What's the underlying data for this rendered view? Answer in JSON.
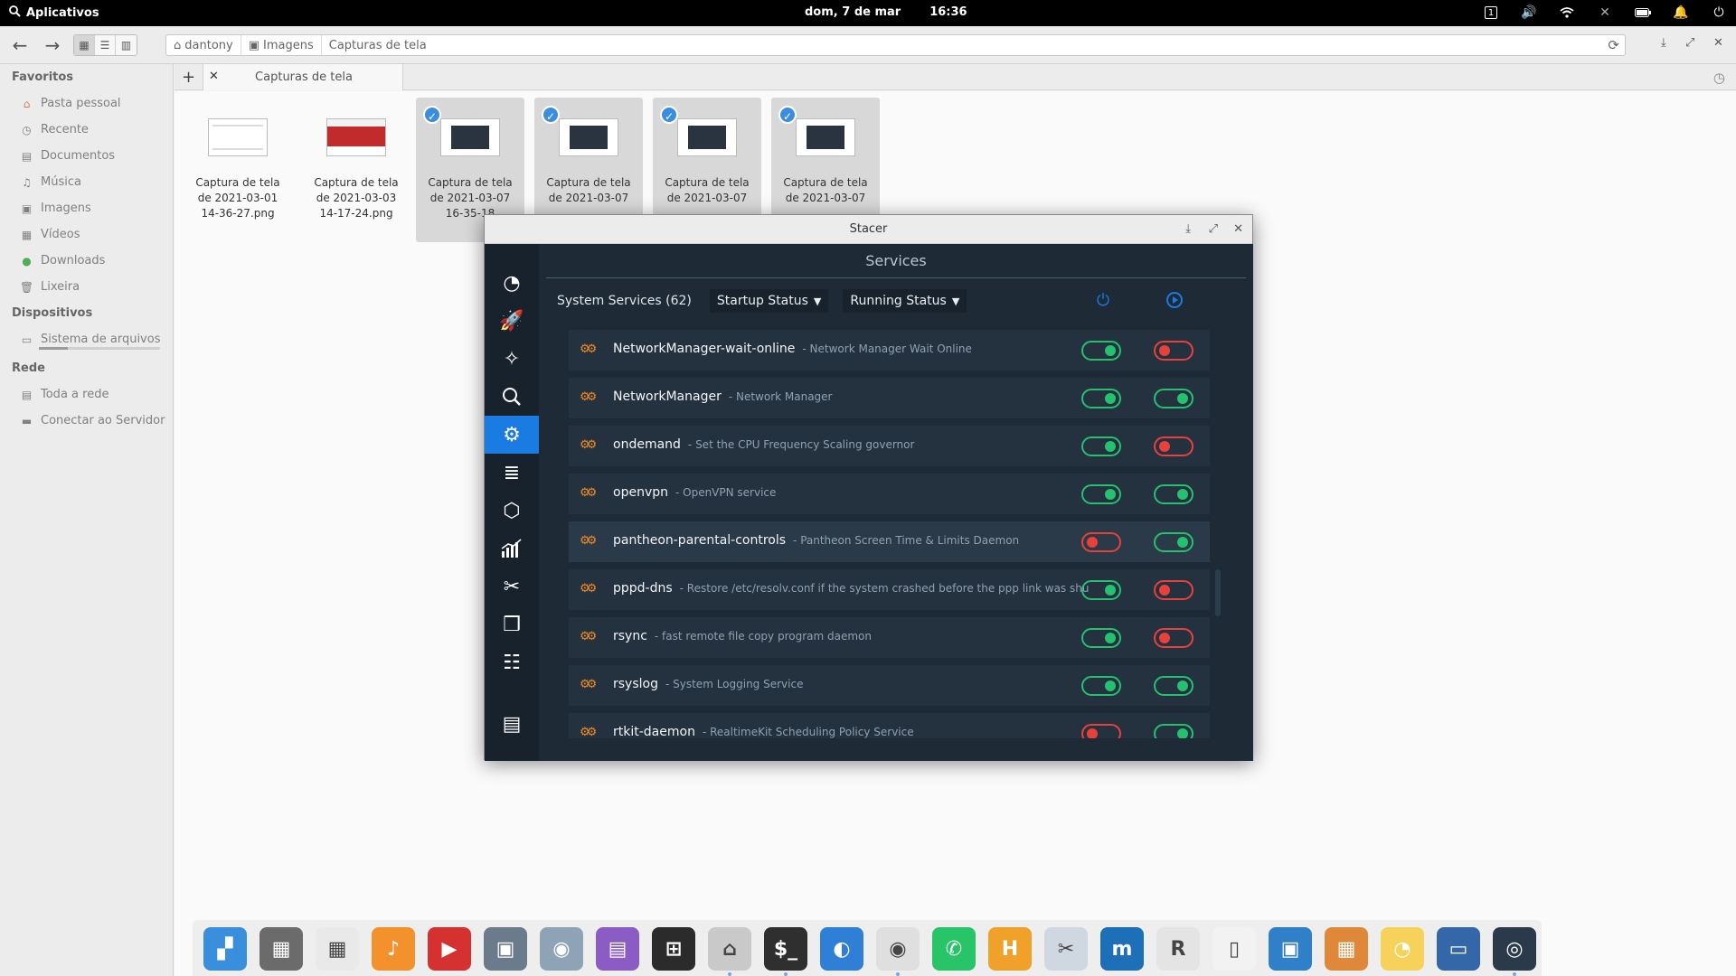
{
  "topbar": {
    "apps_label": "Aplicativos",
    "date": "dom, 7 de mar",
    "time": "16:36",
    "indicators": [
      "workspace-1",
      "volume-icon",
      "wifi-icon",
      "bluetooth-icon",
      "battery-icon",
      "notifications-icon",
      "power-icon"
    ],
    "workspace_label": "1"
  },
  "toolbar": {
    "back_icon": "back-arrow",
    "forward_icon": "forward-arrow",
    "breadcrumbs": [
      "dantony",
      "Imagens",
      "Capturas de tela"
    ]
  },
  "sidebar": {
    "sections": {
      "favorites": "Favoritos",
      "devices": "Dispositivos",
      "network": "Rede"
    },
    "favorites": [
      "Pasta pessoal",
      "Recente",
      "Documentos",
      "Música",
      "Imagens",
      "Vídeos",
      "Downloads",
      "Lixeira"
    ],
    "devices": [
      "Sistema de arquivos"
    ],
    "filesystem_usage_fraction": 0.24,
    "network": [
      "Toda a rede",
      "Conectar ao Servidor"
    ]
  },
  "tabs": {
    "active_label": "Capturas de tela"
  },
  "files": [
    {
      "name": "Captura de tela de 2021-03-01 14-36-27.png",
      "l1": "Captura de tela",
      "l2": "de 2021-03-01",
      "l3": "14-36-27.png",
      "selected": false
    },
    {
      "name": "Captura de tela de 2021-03-03 14-17-24.png",
      "l1": "Captura de tela",
      "l2": "de 2021-03-03",
      "l3": "14-17-24.png",
      "selected": false
    },
    {
      "l1": "Captura de tela",
      "l2": "de 2021-03-07",
      "l3": "16-35-18",
      "selected": true
    },
    {
      "l1": "Captura de tela",
      "l2": "de 2021-03-07",
      "l3": "",
      "selected": true
    },
    {
      "l1": "Captura de tela",
      "l2": "de 2021-03-07",
      "l3": "",
      "selected": true
    },
    {
      "l1": "Captura de tela",
      "l2": "de 2021-03-07",
      "l3": "",
      "selected": true
    }
  ],
  "stacer": {
    "window_title": "Stacer",
    "page_title": "Services",
    "services_count_label": "System Services (62)",
    "startup_filter": "Startup Status",
    "running_filter": "Running Status",
    "nav": [
      "dashboard-icon",
      "startup-apps-icon",
      "system-cleaner-icon",
      "search-icon",
      "services-icon",
      "processes-icon",
      "uninstaller-icon",
      "resources-icon",
      "helpers-icon",
      "apt-repository-icon",
      "settings-icon",
      "feedback-icon"
    ],
    "services": [
      {
        "name": "NetworkManager-wait-online",
        "desc": "- Network Manager Wait Online",
        "startup": true,
        "running": false
      },
      {
        "name": "NetworkManager",
        "desc": "- Network Manager",
        "startup": true,
        "running": true
      },
      {
        "name": "ondemand",
        "desc": "- Set the CPU Frequency Scaling governor",
        "startup": true,
        "running": false
      },
      {
        "name": "openvpn",
        "desc": "- OpenVPN service",
        "startup": true,
        "running": true
      },
      {
        "name": "pantheon-parental-controls",
        "desc": "- Pantheon Screen Time & Limits Daemon",
        "startup": false,
        "running": true
      },
      {
        "name": "pppd-dns",
        "desc": "- Restore /etc/resolv.conf if the system crashed before the ppp link was shu",
        "startup": true,
        "running": false
      },
      {
        "name": "rsync",
        "desc": "- fast remote file copy program daemon",
        "startup": true,
        "running": false
      },
      {
        "name": "rsyslog",
        "desc": "- System Logging Service",
        "startup": true,
        "running": true
      },
      {
        "name": "rtkit-daemon",
        "desc": "- RealtimeKit Scheduling Policy Service",
        "startup": false,
        "running": true
      }
    ]
  },
  "dock": {
    "apps": [
      "multitasking-view",
      "calculator",
      "calendar",
      "music",
      "videos",
      "photos",
      "system-settings",
      "app-center",
      "shortcut-overlay",
      "files",
      "terminal",
      "web-browser",
      "chrome",
      "whatsapp",
      "hemingway",
      "screenshot",
      "writer",
      "r-language",
      "text-document",
      "image-viewer",
      "presentation",
      "drawing",
      "keyboard-settings",
      "stacer"
    ]
  }
}
